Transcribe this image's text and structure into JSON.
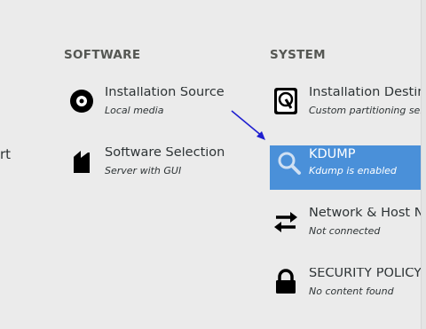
{
  "sections": {
    "software": "SOFTWARE",
    "system": "SYSTEM"
  },
  "left_cut_text": "rt",
  "spokes": {
    "installation_source": {
      "title": "Installation Source",
      "status": "Local media",
      "icon": "disc-icon"
    },
    "software_selection": {
      "title": "Software Selection",
      "status": "Server with GUI",
      "icon": "package-icon"
    },
    "installation_destination": {
      "title": "Installation Destin",
      "status": "Custom partitioning selecte",
      "icon": "harddisk-icon"
    },
    "kdump": {
      "title": "KDUMP",
      "status": "Kdump is enabled",
      "icon": "magnifier-icon",
      "selected": true
    },
    "network": {
      "title": "Network & Host N",
      "status": "Not connected",
      "icon": "network-arrows-icon"
    },
    "security_policy": {
      "title": "SECURITY POLICY",
      "status": "No content found",
      "icon": "lock-icon"
    }
  },
  "colors": {
    "background": "#ebebeb",
    "selected": "#4a90d9",
    "annotation_arrow": "#1f1fd0"
  }
}
